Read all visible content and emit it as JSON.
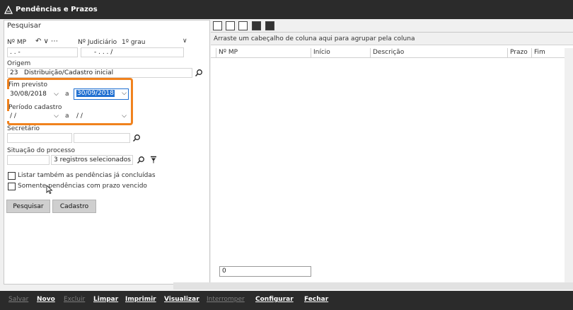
{
  "window": {
    "title": "Pendências e Prazos"
  },
  "search": {
    "section_title": "Pesquisar",
    "nmp_label": "Nº MP",
    "nmp_value": "  .      .      -",
    "nmp_tools": "↶ ∨ ⋯",
    "judicial_label": "Nº Judiciário",
    "grau_label": "1º grau",
    "judicial_value": "-   .   .   .  /",
    "origem_label": "Origem",
    "origem_code": "23",
    "origem_value": "Distribuição/Cadastro inicial",
    "fim_previsto_label": "Fim previsto",
    "fim_previsto_from": "30/08/2018",
    "a_label": "a",
    "fim_previsto_to": "30/09/2018",
    "periodo_label": "Período cadastro",
    "periodo_from": " / /",
    "periodo_to": " / /",
    "secretario_label": "Secretário",
    "situacao_label": "Situação do processo",
    "situacao_value": "3 registros selecionados",
    "check_concluidas": "Listar também as pendências já concluídas",
    "check_vencido": "Somente pendências com prazo vencido",
    "btn_pesquisar": "Pesquisar",
    "btn_cadastro": "Cadastro"
  },
  "grid": {
    "group_hint": "Arraste um cabeçalho de coluna aqui para agrupar pela coluna",
    "columns": [
      "Nº MP",
      "Início",
      "Descrição",
      "Prazo",
      "Fim"
    ],
    "count": "0"
  },
  "toolbar": {
    "salvar": "Salvar",
    "novo": "Novo",
    "excluir": "Excluir",
    "limpar": "Limpar",
    "imprimir": "Imprimir",
    "visualizar": "Visualizar",
    "interromper": "Interromper",
    "configurar": "Configurar",
    "fechar": "Fechar"
  },
  "colors": {
    "highlight": "#f0821e",
    "selection": "#1f6fd1",
    "titlebar": "#2b2b2b"
  }
}
